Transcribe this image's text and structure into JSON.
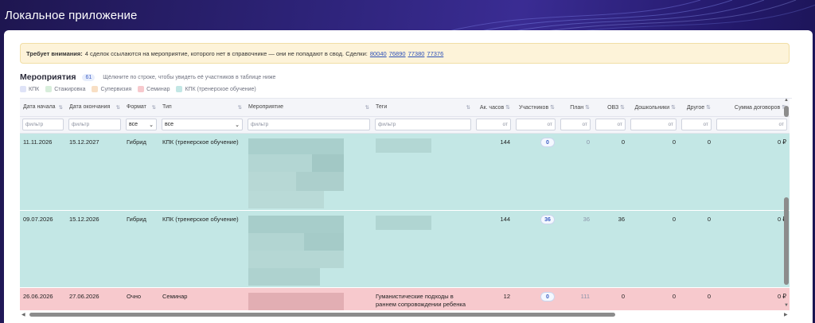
{
  "app": {
    "title": "Локальное приложение"
  },
  "alert": {
    "label": "Требует внимания:",
    "text": "4 сделок ссылаются на мероприятие, которого нет в справочнике — они не попадают в свод. Сделки:",
    "deals": [
      "80040",
      "76890",
      "77380",
      "77376"
    ]
  },
  "events": {
    "title": "Мероприятия",
    "count": "61",
    "hint": "Щёлкните по строке, чтобы увидеть её участников в таблице ниже"
  },
  "legend": [
    {
      "label": "КПК",
      "color": "#dfe3f7"
    },
    {
      "label": "Стажировка",
      "color": "#d8eedb"
    },
    {
      "label": "Супервизия",
      "color": "#f8dfc4"
    },
    {
      "label": "Семинар",
      "color": "#f7c9cd"
    },
    {
      "label": "КПК (тренерское обучение)",
      "color": "#c3e7e5"
    }
  ],
  "columns": [
    "Дата начала",
    "Дата окончания",
    "Формат",
    "Тип",
    "Мероприятие",
    "Теги",
    "Ак. часов",
    "Участников",
    "План",
    "ОВЗ",
    "Дошкольники",
    "Другое",
    "Сумма договоров"
  ],
  "filters": {
    "text_placeholder": "фильтр",
    "num_placeholder": "от",
    "format_value": "все",
    "type_value": "все"
  },
  "rows": [
    {
      "start": "11.11.2026",
      "end": "15.12.2027",
      "format": "Гибрид",
      "type": "КПК (тренерское обучение)",
      "tags": "",
      "hours": "144",
      "participants": "0",
      "plan": "0",
      "ovz": "0",
      "preschool": "0",
      "other": "0",
      "sum": "0 ₽"
    },
    {
      "start": "09.07.2026",
      "end": "15.12.2026",
      "format": "Гибрид",
      "type": "КПК (тренерское обучение)",
      "tags": "",
      "hours": "144",
      "participants": "36",
      "plan": "36",
      "ovz": "36",
      "preschool": "0",
      "other": "0",
      "sum": "0 ₽"
    },
    {
      "start": "26.06.2026",
      "end": "27.06.2026",
      "format": "Очно",
      "type": "Семинар",
      "tags": "Гуманистические подходы в раннем сопровождении ребенка и семьи. Доступ и Пиком: ...",
      "hours": "12",
      "participants": "0",
      "plan": "111",
      "ovz": "0",
      "preschool": "0",
      "other": "0",
      "sum": "0 ₽"
    }
  ],
  "colors": {
    "header_bg": "#2d2378",
    "alert_bg": "#fdf3d9",
    "row_kpk_trainer": "#c3e7e5",
    "row_seminar": "#f7c9cd",
    "link": "#2b4fb8"
  }
}
